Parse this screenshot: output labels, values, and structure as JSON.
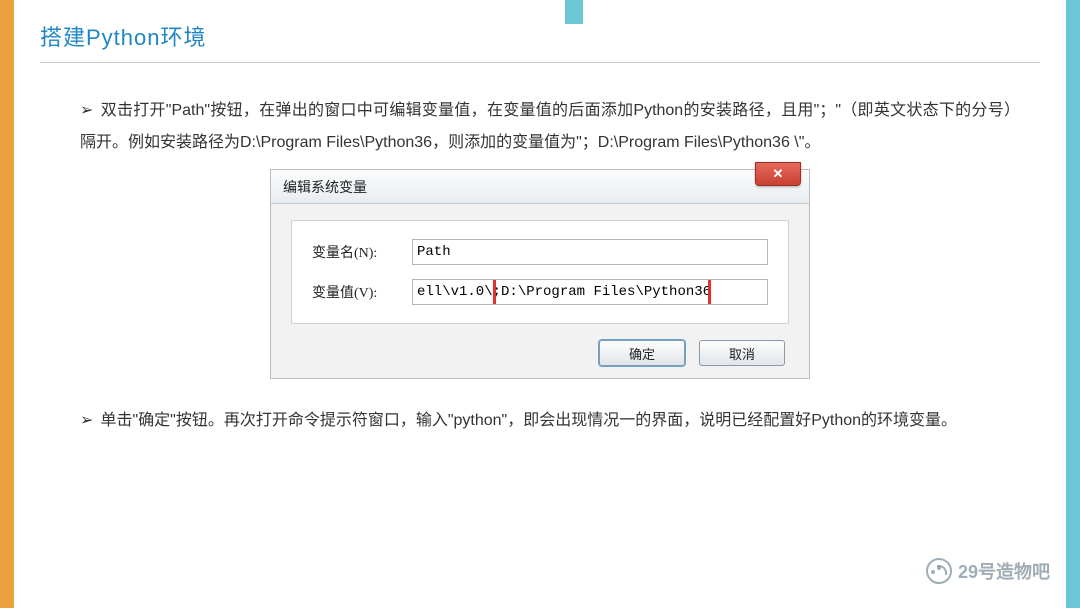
{
  "title": "搭建Python环境",
  "bullet": "➢",
  "para1": "双击打开\"Path\"按钮，在弹出的窗口中可编辑变量值，在变量值的后面添加Python的安装路径，且用\"；\"（即英文状态下的分号）隔开。例如安装路径为D:\\Program Files\\Python36，则添加的变量值为\"；D:\\Program Files\\Python36 \\\"。",
  "dialog": {
    "title": "编辑系统变量",
    "close_label": "✕",
    "name_label": "变量名(N):",
    "name_value": "Path",
    "value_label": "变量值(V):",
    "value_prefix": "ell\\v1.0\\",
    "value_highlight": ";D:\\Program Files\\Python36",
    "ok": "确定",
    "cancel": "取消"
  },
  "para2": "单击\"确定\"按钮。再次打开命令提示符窗口，输入\"python\"，即会出现情况一的界面，说明已经配置好Python的环境变量。",
  "watermark": "29号造物吧"
}
